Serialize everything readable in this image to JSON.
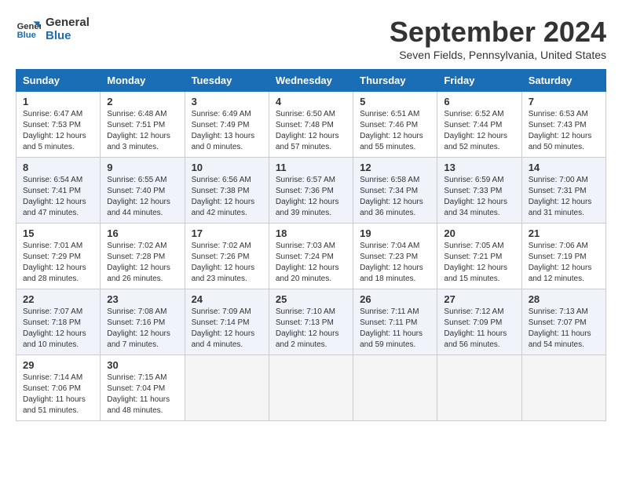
{
  "header": {
    "logo_line1": "General",
    "logo_line2": "Blue",
    "month_title": "September 2024",
    "location": "Seven Fields, Pennsylvania, United States"
  },
  "columns": [
    "Sunday",
    "Monday",
    "Tuesday",
    "Wednesday",
    "Thursday",
    "Friday",
    "Saturday"
  ],
  "weeks": [
    [
      {
        "day": 1,
        "sunrise": "6:47 AM",
        "sunset": "7:53 PM",
        "daylight": "12 hours and 5 minutes"
      },
      {
        "day": 2,
        "sunrise": "6:48 AM",
        "sunset": "7:51 PM",
        "daylight": "12 hours and 3 minutes"
      },
      {
        "day": 3,
        "sunrise": "6:49 AM",
        "sunset": "7:49 PM",
        "daylight": "13 hours and 0 minutes"
      },
      {
        "day": 4,
        "sunrise": "6:50 AM",
        "sunset": "7:48 PM",
        "daylight": "12 hours and 57 minutes"
      },
      {
        "day": 5,
        "sunrise": "6:51 AM",
        "sunset": "7:46 PM",
        "daylight": "12 hours and 55 minutes"
      },
      {
        "day": 6,
        "sunrise": "6:52 AM",
        "sunset": "7:44 PM",
        "daylight": "12 hours and 52 minutes"
      },
      {
        "day": 7,
        "sunrise": "6:53 AM",
        "sunset": "7:43 PM",
        "daylight": "12 hours and 50 minutes"
      }
    ],
    [
      {
        "day": 8,
        "sunrise": "6:54 AM",
        "sunset": "7:41 PM",
        "daylight": "12 hours and 47 minutes"
      },
      {
        "day": 9,
        "sunrise": "6:55 AM",
        "sunset": "7:40 PM",
        "daylight": "12 hours and 44 minutes"
      },
      {
        "day": 10,
        "sunrise": "6:56 AM",
        "sunset": "7:38 PM",
        "daylight": "12 hours and 42 minutes"
      },
      {
        "day": 11,
        "sunrise": "6:57 AM",
        "sunset": "7:36 PM",
        "daylight": "12 hours and 39 minutes"
      },
      {
        "day": 12,
        "sunrise": "6:58 AM",
        "sunset": "7:34 PM",
        "daylight": "12 hours and 36 minutes"
      },
      {
        "day": 13,
        "sunrise": "6:59 AM",
        "sunset": "7:33 PM",
        "daylight": "12 hours and 34 minutes"
      },
      {
        "day": 14,
        "sunrise": "7:00 AM",
        "sunset": "7:31 PM",
        "daylight": "12 hours and 31 minutes"
      }
    ],
    [
      {
        "day": 15,
        "sunrise": "7:01 AM",
        "sunset": "7:29 PM",
        "daylight": "12 hours and 28 minutes"
      },
      {
        "day": 16,
        "sunrise": "7:02 AM",
        "sunset": "7:28 PM",
        "daylight": "12 hours and 26 minutes"
      },
      {
        "day": 17,
        "sunrise": "7:02 AM",
        "sunset": "7:26 PM",
        "daylight": "12 hours and 23 minutes"
      },
      {
        "day": 18,
        "sunrise": "7:03 AM",
        "sunset": "7:24 PM",
        "daylight": "12 hours and 20 minutes"
      },
      {
        "day": 19,
        "sunrise": "7:04 AM",
        "sunset": "7:23 PM",
        "daylight": "12 hours and 18 minutes"
      },
      {
        "day": 20,
        "sunrise": "7:05 AM",
        "sunset": "7:21 PM",
        "daylight": "12 hours and 15 minutes"
      },
      {
        "day": 21,
        "sunrise": "7:06 AM",
        "sunset": "7:19 PM",
        "daylight": "12 hours and 12 minutes"
      }
    ],
    [
      {
        "day": 22,
        "sunrise": "7:07 AM",
        "sunset": "7:18 PM",
        "daylight": "12 hours and 10 minutes"
      },
      {
        "day": 23,
        "sunrise": "7:08 AM",
        "sunset": "7:16 PM",
        "daylight": "12 hours and 7 minutes"
      },
      {
        "day": 24,
        "sunrise": "7:09 AM",
        "sunset": "7:14 PM",
        "daylight": "12 hours and 4 minutes"
      },
      {
        "day": 25,
        "sunrise": "7:10 AM",
        "sunset": "7:13 PM",
        "daylight": "12 hours and 2 minutes"
      },
      {
        "day": 26,
        "sunrise": "7:11 AM",
        "sunset": "7:11 PM",
        "daylight": "11 hours and 59 minutes"
      },
      {
        "day": 27,
        "sunrise": "7:12 AM",
        "sunset": "7:09 PM",
        "daylight": "11 hours and 56 minutes"
      },
      {
        "day": 28,
        "sunrise": "7:13 AM",
        "sunset": "7:07 PM",
        "daylight": "11 hours and 54 minutes"
      }
    ],
    [
      {
        "day": 29,
        "sunrise": "7:14 AM",
        "sunset": "7:06 PM",
        "daylight": "11 hours and 51 minutes"
      },
      {
        "day": 30,
        "sunrise": "7:15 AM",
        "sunset": "7:04 PM",
        "daylight": "11 hours and 48 minutes"
      },
      null,
      null,
      null,
      null,
      null
    ]
  ]
}
